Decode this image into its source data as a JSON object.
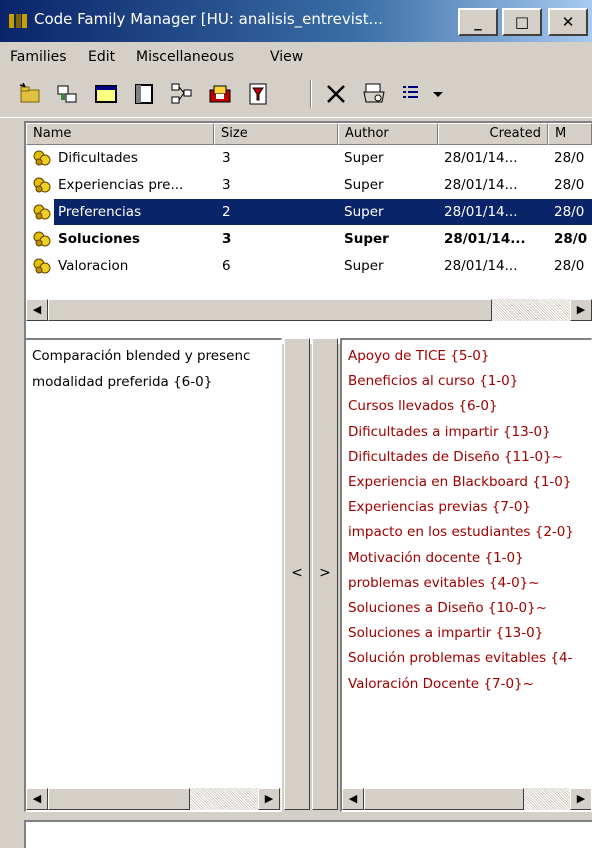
{
  "window": {
    "title": "Code Family Manager [HU: analisis_entrevist...",
    "minimize_label": "_",
    "maximize_label": "□",
    "close_label": "✕"
  },
  "menu": [
    {
      "label": "Families",
      "icon": "none"
    },
    {
      "label": "Edit"
    },
    {
      "label": "Miscellaneous"
    },
    {
      "label": "View"
    }
  ],
  "toolbar": {
    "icons": [
      "new-family-icon",
      "copy-family-icon",
      "comment-icon",
      "edit-icon",
      "network-icon",
      "output-icon",
      "filter-icon",
      "delete-icon",
      "print-icon",
      "list-view-icon",
      "dropdown-icon"
    ]
  },
  "families_list": {
    "columns": [
      "Name",
      "Size",
      "Author",
      "Created",
      "M"
    ],
    "rows": [
      {
        "name": "Dificultades",
        "size": "3",
        "author": "Super",
        "created": "28/01/14...",
        "modified": "28/0"
      },
      {
        "name": "Experiencias pre...",
        "size": "3",
        "author": "Super",
        "created": "28/01/14...",
        "modified": "28/0"
      },
      {
        "name": "Preferencias",
        "size": "2",
        "author": "Super",
        "created": "28/01/14...",
        "modified": "28/0",
        "selected": true
      },
      {
        "name": "Soluciones",
        "size": "3",
        "author": "Super",
        "created": "28/01/14...",
        "modified": "28/0",
        "bold": true
      },
      {
        "name": "Valoracion",
        "size": "6",
        "author": "Super",
        "created": "28/01/14...",
        "modified": "28/0"
      }
    ]
  },
  "members_pane": {
    "items": [
      "Comparación blended y presenc",
      "modalidad preferida {6-0}"
    ]
  },
  "move_buttons": {
    "left": "<",
    "right": ">"
  },
  "non_members_pane": {
    "items": [
      "Apoyo de TICE {5-0}",
      "Beneficios al curso {1-0}",
      "Cursos llevados {6-0}",
      "Dificultades a impartir {13-0}",
      "Dificultades de Diseño {11-0}~",
      "Experiencia en Blackboard {1-0}",
      "Experiencias previas {7-0}",
      "impacto en los estudiantes {2-0}",
      "Motivación docente {1-0}",
      "problemas evitables {4-0}~",
      "Soluciones a Diseño {10-0}~",
      "Soluciones a impartir {13-0}",
      "Solución problemas evitables {4-",
      "Valoración Docente {7-0}~"
    ]
  },
  "colors": {
    "titlebar_start": "#0a246a",
    "titlebar_end": "#a6caf0",
    "selection": "#0a246a",
    "non_member_text": "#a00000",
    "chrome": "#d4d0c8"
  }
}
